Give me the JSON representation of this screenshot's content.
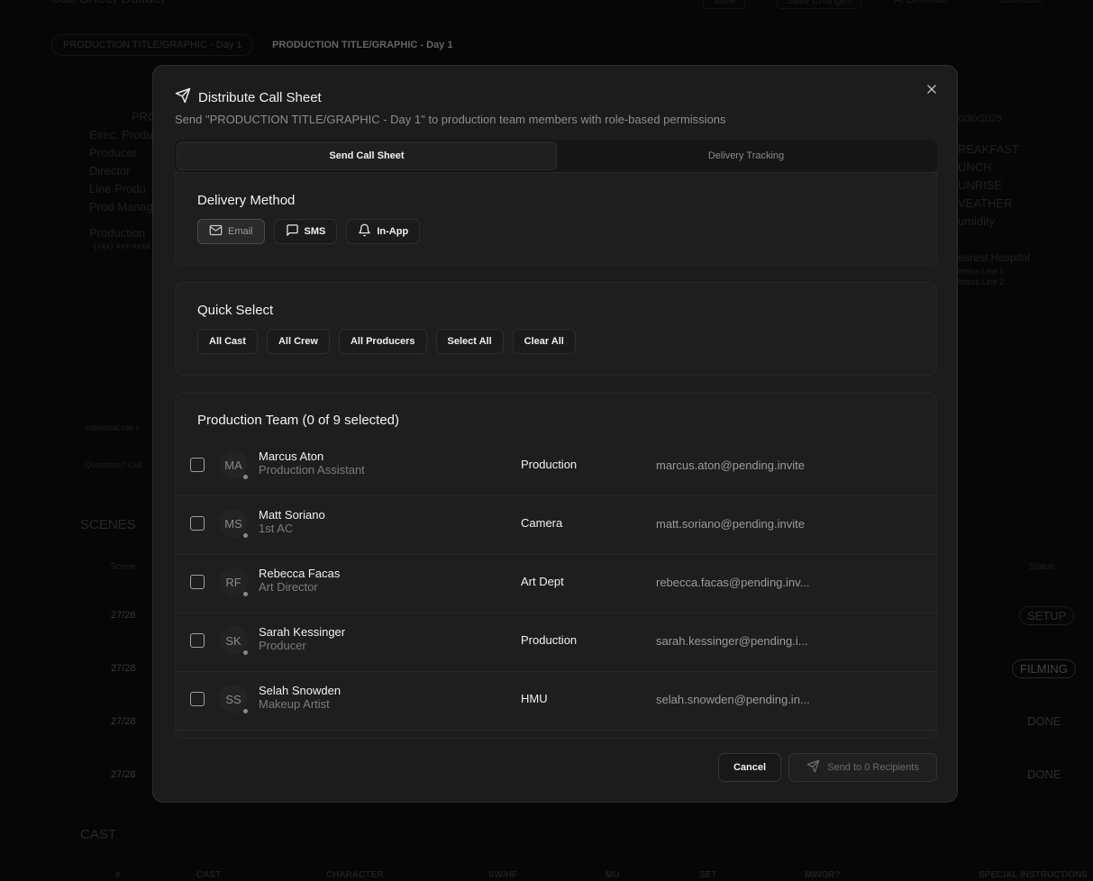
{
  "background": {
    "app_title": "Call Sheet Builder",
    "top_buttons": [
      "Save",
      "Save Changes",
      "AI Generate",
      "Distribute"
    ],
    "day_tab": "PRODUCTION TITLE/GRAPHIC - Day 1",
    "day_tab_active": "PRODUCTION TITLE/GRAPHIC - Day 1",
    "left_labels": [
      "Exec. Produ",
      "Producer",
      "Director",
      "Line Produ",
      "Prod Manag"
    ],
    "prod_label": "PRO",
    "production_label": "Production",
    "phone": "(xxx) xxx-xxxx",
    "date": "0/30/2025",
    "right_labels": [
      "REAKFAST",
      "UNCH",
      "UNRISE",
      "VEATHER",
      "umidity"
    ],
    "hospital": "earest Hospital",
    "address1": "ldress Line 1",
    "address2": "ldress Line 2",
    "individual": "Individual call ti",
    "questions": "Questions? Call",
    "scenes_title": "SCENES",
    "scene_col": "Scene",
    "status_col": "Status",
    "scenes": [
      {
        "num": "27/28",
        "status": "SETUP"
      },
      {
        "num": "27/28",
        "status": "FILMING"
      },
      {
        "num": "27/28",
        "status": "DONE"
      },
      {
        "num": "27/28",
        "status": "DONE"
      }
    ],
    "cast_title": "CAST",
    "cast_cols": [
      "#",
      "CAST",
      "CHARACTER",
      "SW/HF",
      "MU",
      "SET",
      "MINOR?",
      "SPECIAL INSTRUCTIONS"
    ]
  },
  "modal": {
    "title": "Distribute Call Sheet",
    "subtitle": "Send \"PRODUCTION TITLE/GRAPHIC - Day 1\" to production team members with role-based permissions",
    "tabs": [
      "Send Call Sheet",
      "Delivery Tracking"
    ],
    "delivery": {
      "title": "Delivery Method",
      "options": [
        {
          "label": "Email",
          "icon": "mail-icon"
        },
        {
          "label": "SMS",
          "icon": "message-icon"
        },
        {
          "label": "In-App",
          "icon": "bell-icon"
        }
      ]
    },
    "quick": {
      "title": "Quick Select",
      "buttons": [
        "All Cast",
        "All Crew",
        "All Producers",
        "Select All",
        "Clear All"
      ]
    },
    "team": {
      "title": "Production Team (0 of 9 selected)",
      "members": [
        {
          "initials": "MA",
          "name": "Marcus Aton",
          "role": "Production Assistant",
          "dept": "Production",
          "email": "marcus.aton@pending.invite"
        },
        {
          "initials": "MS",
          "name": "Matt Soriano",
          "role": "1st AC",
          "dept": "Camera",
          "email": "matt.soriano@pending.invite"
        },
        {
          "initials": "RF",
          "name": "Rebecca Facas",
          "role": "Art Director",
          "dept": "Art Dept",
          "email": "rebecca.facas@pending.inv..."
        },
        {
          "initials": "SK",
          "name": "Sarah Kessinger",
          "role": "Producer",
          "dept": "Production",
          "email": "sarah.kessinger@pending.i..."
        },
        {
          "initials": "SS",
          "name": "Selah Snowden",
          "role": "Makeup Artist",
          "dept": "HMU",
          "email": "selah.snowden@pending.in..."
        }
      ]
    },
    "cancel_label": "Cancel",
    "send_label": "Send to 0 Recipients"
  }
}
